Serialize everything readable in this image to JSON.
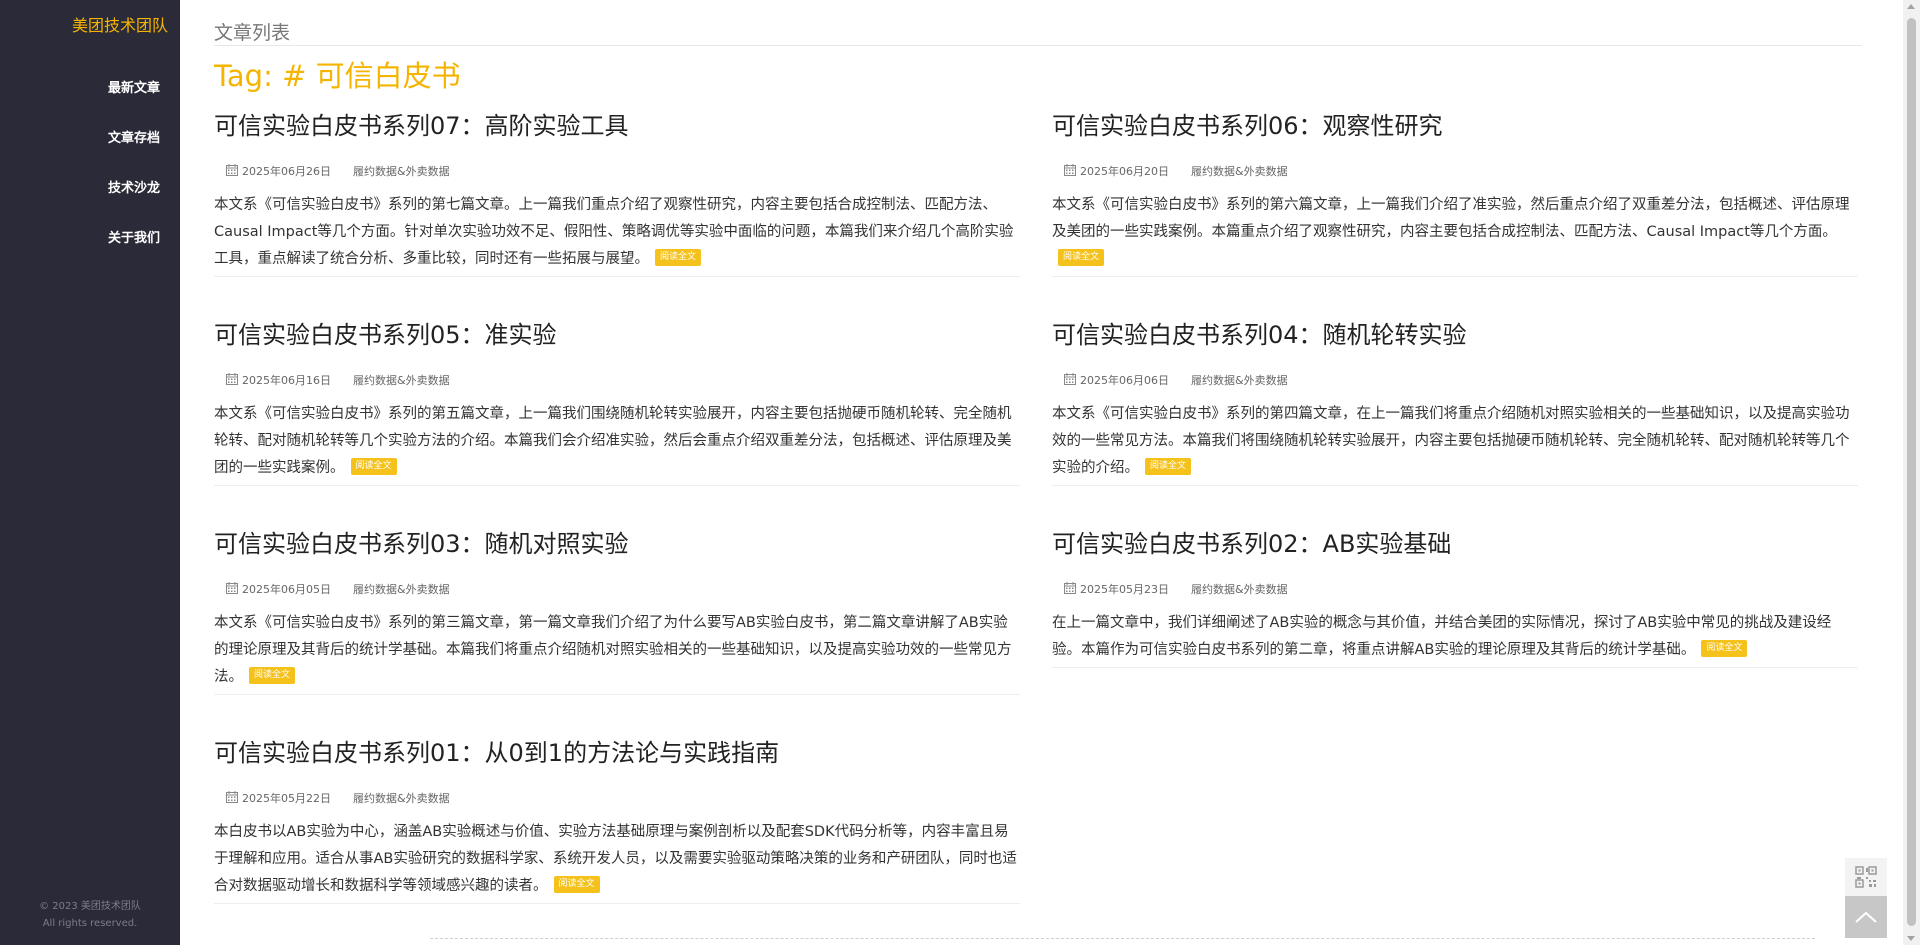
{
  "sidebar": {
    "brand": "美团技术团队",
    "nav": [
      {
        "label": "最新文章"
      },
      {
        "label": "文章存档"
      },
      {
        "label": "技术沙龙"
      },
      {
        "label": "关于我们"
      }
    ],
    "copyright_line1": "© 2023 美团技术团队",
    "copyright_line2": "All rights reserved."
  },
  "main": {
    "breadcrumb": "文章列表",
    "tag_title": "Tag: # 可信白皮书",
    "read_more_label": "阅读全文",
    "articles": [
      {
        "title": "可信实验白皮书系列07：高阶实验工具",
        "date": "2025年06月26日",
        "category": "履约数据&外卖数据",
        "summary": "本文系《可信实验白皮书》系列的第七篇文章。上一篇我们重点介绍了观察性研究，内容主要包括合成控制法、匹配方法、Causal Impact等几个方面。针对单次实验功效不足、假阳性、策略调优等实验中面临的问题，本篇我们来介绍几个高阶实验工具，重点解读了统合分析、多重比较，同时还有一些拓展与展望。"
      },
      {
        "title": "可信实验白皮书系列06：观察性研究",
        "date": "2025年06月20日",
        "category": "履约数据&外卖数据",
        "summary": "本文系《可信实验白皮书》系列的第六篇文章，上一篇我们介绍了准实验，然后重点介绍了双重差分法，包括概述、评估原理及美团的一些实践案例。本篇重点介绍了观察性研究，内容主要包括合成控制法、匹配方法、Causal Impact等几个方面。"
      },
      {
        "title": "可信实验白皮书系列05：准实验",
        "date": "2025年06月16日",
        "category": "履约数据&外卖数据",
        "summary": "本文系《可信实验白皮书》系列的第五篇文章，上一篇我们围绕随机轮转实验展开，内容主要包括抛硬币随机轮转、完全随机轮转、配对随机轮转等几个实验方法的介绍。本篇我们会介绍准实验，然后会重点介绍双重差分法，包括概述、评估原理及美团的一些实践案例。"
      },
      {
        "title": "可信实验白皮书系列04：随机轮转实验",
        "date": "2025年06月06日",
        "category": "履约数据&外卖数据",
        "summary": "本文系《可信实验白皮书》系列的第四篇文章，在上一篇我们将重点介绍随机对照实验相关的一些基础知识，以及提高实验功效的一些常见方法。本篇我们将围绕随机轮转实验展开，内容主要包括抛硬币随机轮转、完全随机轮转、配对随机轮转等几个实验的介绍。"
      },
      {
        "title": "可信实验白皮书系列03：随机对照实验",
        "date": "2025年06月05日",
        "category": "履约数据&外卖数据",
        "summary": "本文系《可信实验白皮书》系列的第三篇文章，第一篇文章我们介绍了为什么要写AB实验白皮书，第二篇文章讲解了AB实验的理论原理及其背后的统计学基础。本篇我们将重点介绍随机对照实验相关的一些基础知识，以及提高实验功效的一些常见方法。"
      },
      {
        "title": "可信实验白皮书系列02：AB实验基础",
        "date": "2025年05月23日",
        "category": "履约数据&外卖数据",
        "summary": "在上一篇文章中，我们详细阐述了AB实验的概念与其价值，并结合美团的实际情况，探讨了AB实验中常见的挑战及建设经验。本篇作为可信实验白皮书系列的第二章，将重点讲解AB实验的理论原理及其背后的统计学基础。"
      },
      {
        "title": "可信实验白皮书系列01：从0到1的方法论与实践指南",
        "date": "2025年05月22日",
        "category": "履约数据&外卖数据",
        "summary": "本白皮书以AB实验为中心，涵盖AB实验概述与价值、实验方法基础原理与案例剖析以及配套SDK代码分析等，内容丰富且易于理解和应用。适合从事AB实验研究的数据科学家、系统开发人员，以及需要实验驱动策略决策的业务和产研团队，同时也适合对数据驱动增长和数据科学等领域感兴趣的读者。"
      }
    ]
  },
  "tools": {
    "qr_icon": "qr-code-icon",
    "back_to_top_icon": "chevron-up-icon"
  },
  "colors": {
    "accent": "#f5b400",
    "sidebar_bg": "#2a2a38"
  }
}
